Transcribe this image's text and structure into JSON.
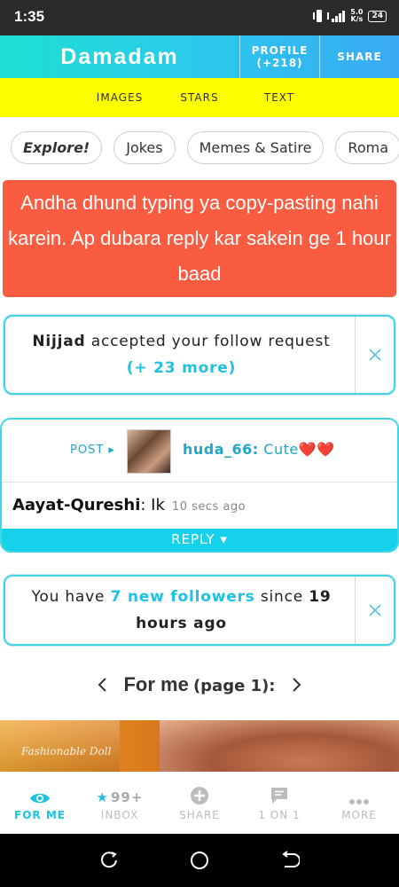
{
  "status_bar": {
    "time": "1:35",
    "network_speed": "5.0\nK/s",
    "battery": "24",
    "network_type": "4G"
  },
  "header": {
    "brand": "Damadam",
    "profile_label": "PROFILE",
    "profile_count": "(+218)",
    "share_label": "SHARE"
  },
  "subnav": [
    "IMAGES",
    "STARS",
    "TEXT"
  ],
  "chips": [
    "Explore!",
    "Jokes",
    "Memes & Satire",
    "Roma"
  ],
  "warning": {
    "text": "Andha dhund typing ya copy-pasting nahi karein. Ap dubara reply kar sakein ge 1 hour baad"
  },
  "follow_card": {
    "name": "Nijjad",
    "text": "accepted your follow request",
    "more": "(+ 23 more)"
  },
  "post": {
    "tag": "POST ▸",
    "author": "huda_66:",
    "text": "Cute❤️❤️",
    "commenter": "Aayat-Qureshi",
    "comment": ": Ik",
    "ago": "10 secs ago",
    "reply": "REPLY ▾"
  },
  "followers_card": {
    "prefix": "You have",
    "highlight": "7 new followers",
    "middle": "since",
    "count": "19",
    "suffix": "hours ago"
  },
  "pager": {
    "title": "For me",
    "sub": "(page 1):"
  },
  "preview": {
    "watermark": "Fashionable Doll"
  },
  "bottom_nav": [
    {
      "label": "FOR ME",
      "icon": "eye-icon",
      "active": true
    },
    {
      "label": "INBOX",
      "icon": "star-icon",
      "badge": "99+"
    },
    {
      "label": "SHARE",
      "icon": "plus-circle-icon"
    },
    {
      "label": "1 ON 1",
      "icon": "chat-icon"
    },
    {
      "label": "MORE",
      "icon": "more-icon"
    }
  ],
  "colors": {
    "accent": "#1fc2e2",
    "warning": "#f95c40",
    "subnav": "#fdff00"
  }
}
